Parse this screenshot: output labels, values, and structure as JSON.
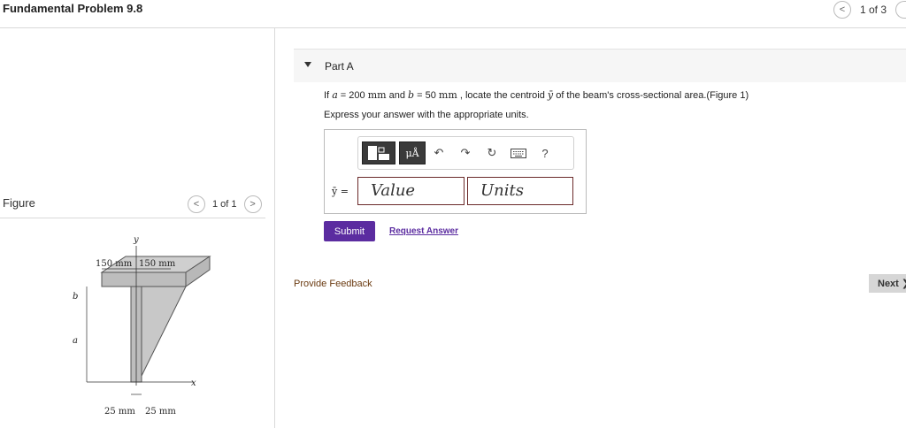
{
  "header": {
    "title": "Fundamental Problem 9.8",
    "pager_text": "1 of 3",
    "prev_glyph": "<"
  },
  "figure_panel": {
    "label": "Figure",
    "pager_text": "1 of 1",
    "prev_glyph": "<",
    "next_glyph": ">",
    "diagram": {
      "y_axis": "y",
      "x_axis": "x",
      "dim_left": "150 mm",
      "dim_right": "150 mm",
      "dim_b": "b",
      "dim_a": "a",
      "dim_bottom_left": "25 mm",
      "dim_bottom_right": "25 mm"
    }
  },
  "part": {
    "title": "Part A",
    "question": {
      "prefix": "If",
      "a_var": "a",
      "a_val": " = 200 ",
      "a_unit": "mm",
      "and": " and ",
      "b_var": "b",
      "b_val": " = 50 ",
      "b_unit": "mm",
      "rest1": " , locate the centroid ",
      "ybar": "ȳ",
      "rest2": " of the beam's cross-sectional area.(Figure 1)"
    },
    "instruction": "Express your answer with the appropriate units."
  },
  "answer": {
    "toolbar": {
      "units_label": "μÅ",
      "undo_icon": "↶",
      "redo_icon": "↷",
      "reset_icon": "↻",
      "help_label": "?"
    },
    "variable_label": "ȳ =",
    "value_placeholder": "Value",
    "units_placeholder": "Units"
  },
  "actions": {
    "submit_label": "Submit",
    "request_answer_label": "Request Answer",
    "feedback_label": "Provide Feedback",
    "next_label": "Next ❯"
  },
  "colors": {
    "primary": "#5b2ca0",
    "feedback": "#6a3a10",
    "input_border": "#6b2a2a"
  }
}
